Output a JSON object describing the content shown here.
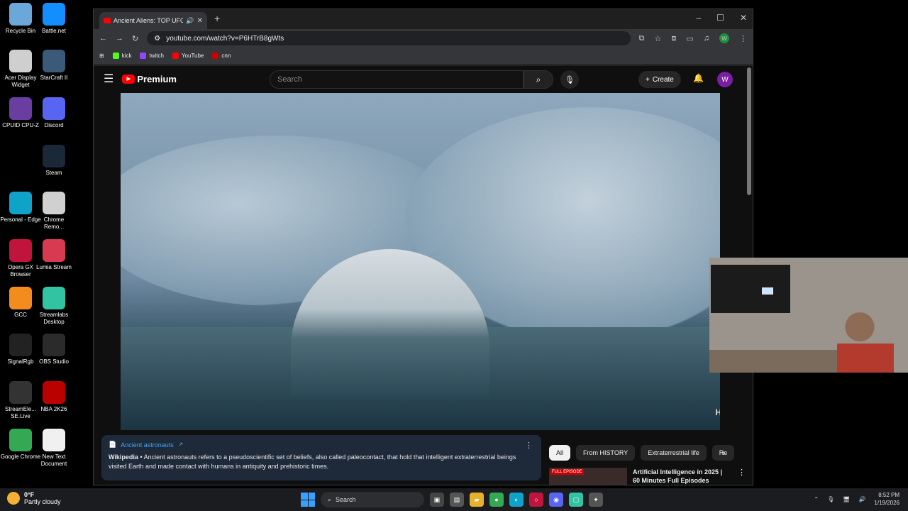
{
  "desktop": {
    "icons": [
      {
        "label": "Recycle Bin",
        "icon": "recycle-bin-icon",
        "color": "#6ba7d9"
      },
      {
        "label": "Battle.net",
        "icon": "battlenet-icon",
        "color": "#148eff"
      },
      {
        "label": "Acer Display Widget",
        "icon": "acer-display-widget-icon",
        "color": "#cfcfcf"
      },
      {
        "label": "StarCraft II",
        "icon": "starcraft-icon",
        "color": "#3b5a7a"
      },
      {
        "label": "CPUID CPU-Z",
        "icon": "cpuz-icon",
        "color": "#6a3ea1"
      },
      {
        "label": "Discord",
        "icon": "discord-icon",
        "color": "#5865f2"
      },
      {
        "label": "Steam",
        "icon": "steam-icon",
        "color": "#1b2838"
      },
      {
        "label": "Personal - Edge",
        "icon": "edge-icon",
        "color": "#0fa3c9"
      },
      {
        "label": "Chrome Remo...",
        "icon": "chrome-remote-icon",
        "color": "#d0d0d0"
      },
      {
        "label": "Opera GX Browser",
        "icon": "opera-gx-icon",
        "color": "#c0143c"
      },
      {
        "label": "Lumia Stream",
        "icon": "lumia-stream-icon",
        "color": "#d83a52"
      },
      {
        "label": "GCC",
        "icon": "gcc-icon",
        "color": "#f28c1f"
      },
      {
        "label": "Streamlabs Desktop",
        "icon": "streamlabs-icon",
        "color": "#31c3a2"
      },
      {
        "label": "SignalRgb",
        "icon": "signalrgb-icon",
        "color": "#222"
      },
      {
        "label": "OBS Studio",
        "icon": "obs-icon",
        "color": "#2b2b2b"
      },
      {
        "label": "StreamEle... SE.Live",
        "icon": "streamelements-icon",
        "color": "#333"
      },
      {
        "label": "NBA 2K26",
        "icon": "nba2k-icon",
        "color": "#b00"
      },
      {
        "label": "Google Chrome",
        "icon": "chrome-icon",
        "color": "#34a853"
      },
      {
        "label": "New Text Document",
        "icon": "text-document-icon",
        "color": "#f0f0f0"
      }
    ]
  },
  "browser": {
    "tab_title": "Ancient Aliens: TOP UFO M",
    "new_tab": "+",
    "url": "youtube.com/watch?v=P6HTrB8gWts",
    "profile_initial": "W",
    "bookmarks": [
      {
        "label": "kick",
        "color": "#53fc18"
      },
      {
        "label": "twitch",
        "color": "#9146ff"
      },
      {
        "label": "YouTube",
        "color": "#ff0000"
      },
      {
        "label": "cnn",
        "color": "#cc0000"
      }
    ]
  },
  "youtube": {
    "logo_text": "Premium",
    "search_placeholder": "Search",
    "create_label": "Create",
    "avatar_initial": "W",
    "channel_watermark": "H",
    "info_card": {
      "topic": "Ancient astronauts",
      "source": "Wikipedia",
      "text": "Ancient astronauts refers to a pseudoscientific set of beliefs, also called paleocontact, that hold that intelligent extraterrestrial beings visited Earth and made contact with humans in antiquity and prehistoric times."
    },
    "chips": [
      "All",
      "From HISTORY",
      "Extraterrestrial life",
      "Re"
    ],
    "recommendation": {
      "badge": "FULL EPISODE",
      "title": "Artificial Intelligence in 2025 | 60 Minutes Full Episodes"
    }
  },
  "taskbar": {
    "weather_temp": "0°F",
    "weather_desc": "Partly cloudy",
    "search_label": "Search",
    "time": "8:52 PM",
    "date": "1/19/2026"
  }
}
